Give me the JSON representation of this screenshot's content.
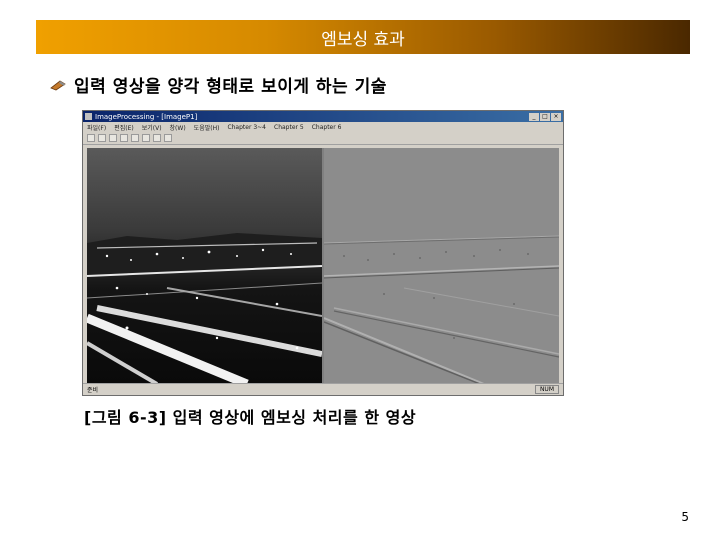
{
  "slide": {
    "title": "엠보싱 효과",
    "bullet": "입력 영상을 양각 형태로 보이게 하는 기술",
    "caption": "[그림 6-3] 입력 영상에 엠보싱 처리를 한 영상",
    "page_number": "5"
  },
  "app_window": {
    "title": "ImageProcessing - [ImageP1]",
    "menu_items": [
      "파일(F)",
      "편집(E)",
      "보기(V)",
      "창(W)",
      "도움말(H)",
      "Chapter 3~4",
      "Chapter 5",
      "Chapter 6"
    ],
    "controls": [
      "_",
      "□",
      "×"
    ],
    "status_left": "준비",
    "status_right": "NUM"
  },
  "colors": {
    "title_bar_start": "#f0a000",
    "title_bar_end": "#4a2800",
    "window_title": "#0a246a"
  },
  "icons": [
    "bullet-icon",
    "new-file-icon",
    "open-file-icon",
    "save-icon",
    "cut-icon",
    "copy-icon",
    "paste-icon",
    "print-icon",
    "help-icon"
  ]
}
